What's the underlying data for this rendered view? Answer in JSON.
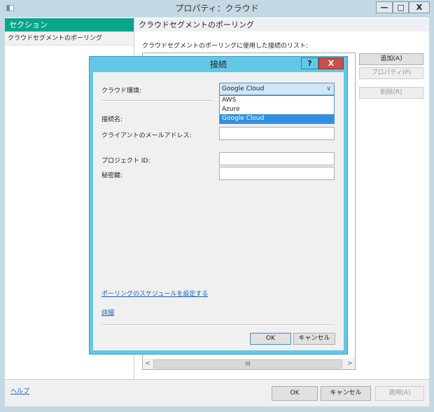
{
  "window": {
    "title": "プロパティ：クラウド",
    "minimize": "—",
    "maximize": "□",
    "close": "X"
  },
  "sidebar": {
    "header": "セクション",
    "items": [
      {
        "label": "クラウドセグメントのポーリング"
      }
    ]
  },
  "pane": {
    "header": "クラウドセグメントのポーリング",
    "list_label": "クラウドセグメントのポーリングに使用した接続のリスト:",
    "add": "追加(A)",
    "properties": "プロパティ(P)",
    "delete": "削除(R)",
    "scroll_left": "<",
    "scroll_thumb": "III",
    "scroll_right": ">"
  },
  "dialog": {
    "title": "接続",
    "help": "?",
    "close": "X",
    "cloud_env_label": "クラウド環境:",
    "cloud_env_value": "Google Cloud",
    "options": [
      "AWS",
      "Azure",
      "Google Cloud"
    ],
    "connection_name_label": "接続名:",
    "client_email_label": "クライアントのメールアドレス:",
    "project_id_label": "プロジェクト ID:",
    "secret_key_label": "秘密鍵:",
    "schedule_link": "ポーリングのスケジュールを設定する",
    "details_link": "詳細",
    "ok": "OK",
    "cancel": "キャンセル"
  },
  "footer": {
    "help": "ヘルプ",
    "ok": "OK",
    "cancel": "キャンセル",
    "apply": "適用(A)"
  }
}
